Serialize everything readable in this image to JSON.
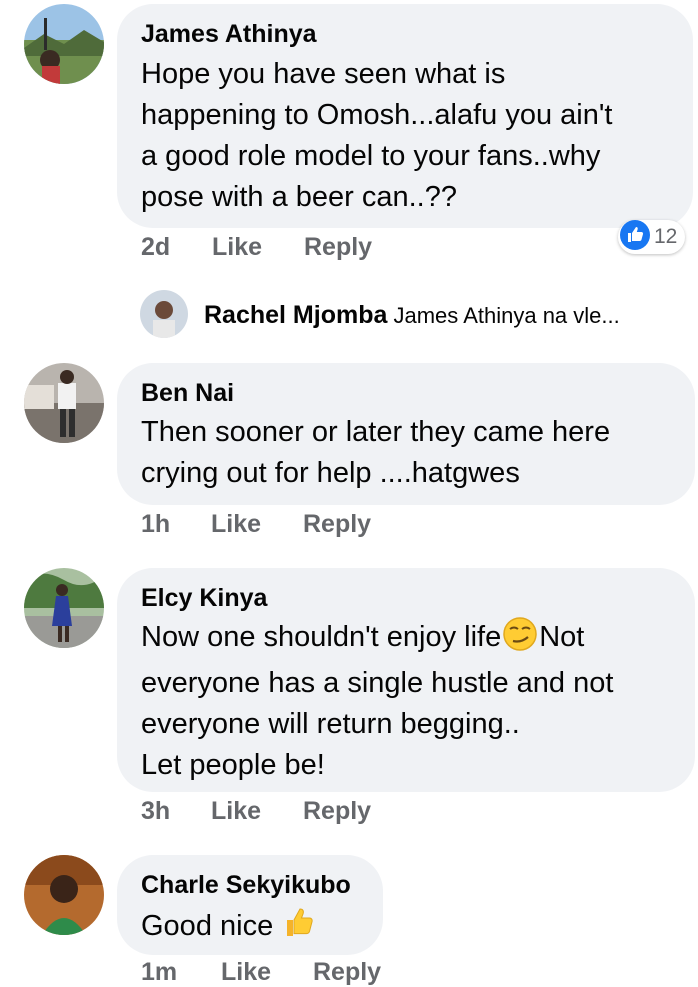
{
  "comments": [
    {
      "author": "James Athinya",
      "lines": [
        "Hope you have seen what is",
        "happening to Omosh...alafu you ain't",
        "a good role model to your fans..why",
        "pose with a beer can..??"
      ],
      "time": "2d",
      "reaction_count": "12",
      "reply_preview": {
        "author": "Rachel Mjomba",
        "text": "James Athinya na vle..."
      }
    },
    {
      "author": "Ben Nai",
      "lines": [
        "Then sooner or later they came here",
        "crying out for help ....hatgwes"
      ],
      "time": "1h"
    },
    {
      "author": "Elcy Kinya",
      "lines": [
        "Now one shouldn't enjoy life",
        "everyone has a single hustle and not",
        "everyone will return begging..",
        "Let people be!"
      ],
      "line1_suffix": "Not",
      "time": "3h"
    },
    {
      "author": "Charle Sekyikubo",
      "lines": [
        "Good nice"
      ],
      "time": "1m"
    }
  ],
  "actions": {
    "like": "Like",
    "reply": "Reply"
  },
  "icons": {
    "reaction": "like-thumb-icon",
    "smirk": "smirk-emoji-icon",
    "thumbs": "thumbs-up-emoji-icon"
  },
  "colors": {
    "bubble": "#f0f2f5",
    "like_blue": "#1877f2",
    "meta_gray": "#65676b"
  }
}
